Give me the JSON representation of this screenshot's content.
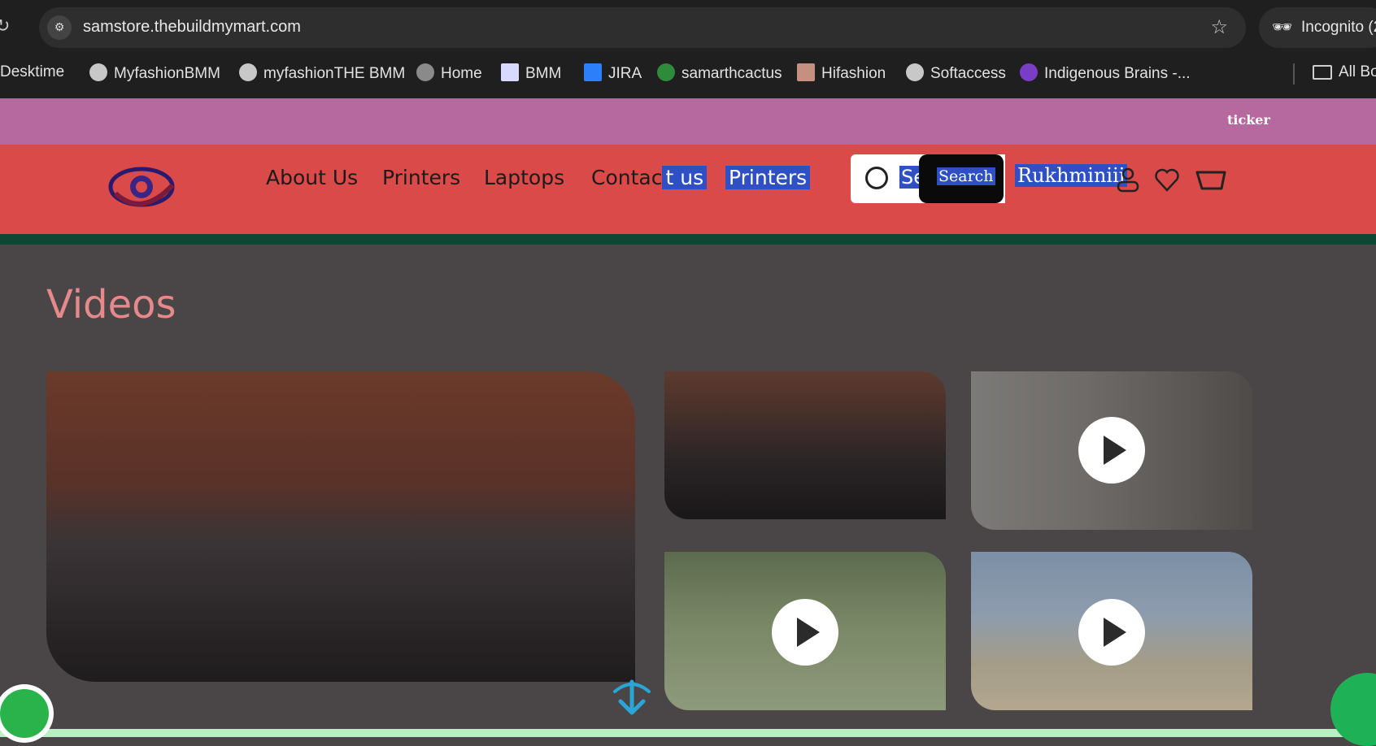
{
  "browser": {
    "url": "samstore.thebuildmymart.com",
    "incognito_label": "Incognito (2",
    "bookmarks": [
      {
        "label": "Desktime",
        "color": "#555555"
      },
      {
        "label": "MyfashionBMM",
        "color": "#c8c8c8"
      },
      {
        "label": "myfashionTHE BMM",
        "color": "#c8c8c8"
      },
      {
        "label": "Home",
        "color": "#8a8a8a"
      },
      {
        "label": "BMM",
        "color": "#d9d9ff"
      },
      {
        "label": "JIRA",
        "color": "#2d7ff9"
      },
      {
        "label": "samarthcactus",
        "color": "#2e8b3a"
      },
      {
        "label": "Hifashion",
        "color": "#c59080"
      },
      {
        "label": "Softaccess",
        "color": "#c8c8c8"
      },
      {
        "label": "Indigenous Brains -...",
        "color": "#7a3dc8"
      }
    ],
    "all_bookmarks_label": "All Bo"
  },
  "ticker": {
    "text": "ticker"
  },
  "header": {
    "nav": {
      "about": "About Us",
      "printers": "Printers",
      "laptops": "Laptops",
      "contact_a": "Contac",
      "contact_b": "t us",
      "printers2": "Printers"
    },
    "search": {
      "value": "Se",
      "button": "Search"
    },
    "user_name": "Rukhminiii"
  },
  "main": {
    "section_title": "Videos"
  },
  "colors": {
    "ticker_bg": "#b5699f",
    "header_bg": "#da4a48",
    "accent_green": "#0f4634",
    "title_pink": "#e5898b",
    "selection_blue": "#2f4fc4"
  }
}
